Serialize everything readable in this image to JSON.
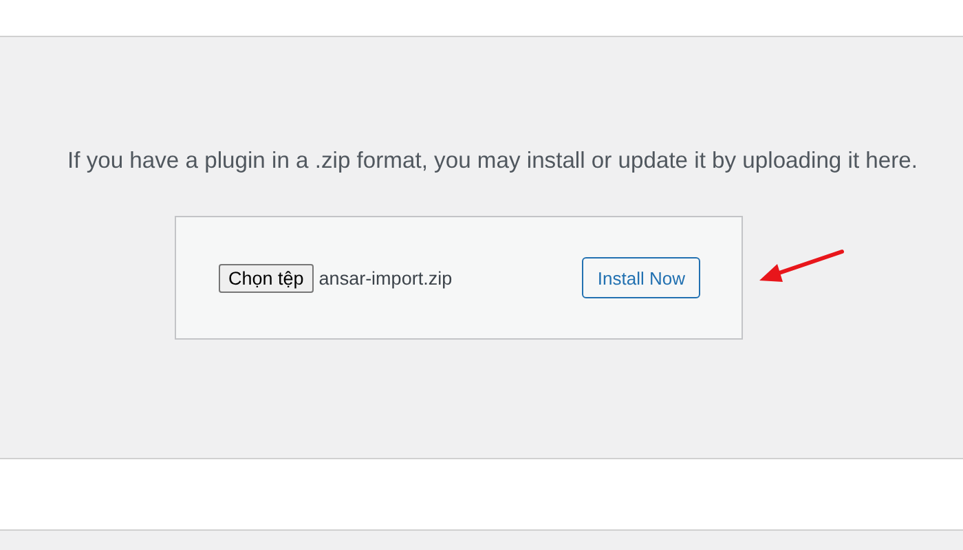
{
  "intro": "If you have a plugin in a .zip format, you may install or update it by uploading it here.",
  "upload": {
    "choose_button": "Chọn tệp",
    "file_name": "ansar-import.zip",
    "install_button": "Install Now"
  }
}
